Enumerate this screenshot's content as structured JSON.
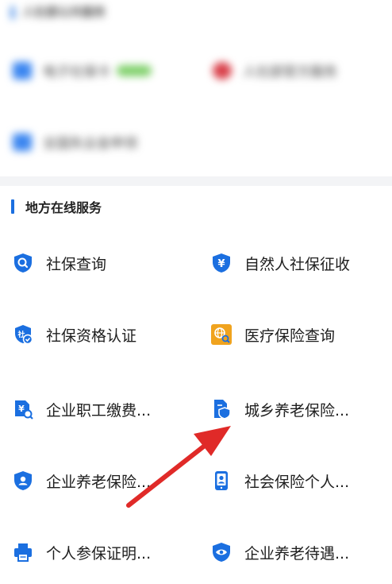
{
  "blurred_section": {
    "title": "人社部公共服务",
    "items": [
      {
        "label": "电子社保卡",
        "icon": "card-icon",
        "badge": ""
      },
      {
        "label": "人社部官方服务",
        "icon": "emblem-icon"
      },
      {
        "label": "全国失业金申领",
        "icon": "document-icon"
      }
    ]
  },
  "local_section": {
    "title": "地方在线服务",
    "items": [
      {
        "label": "社保查询",
        "icon": "shield-search-icon"
      },
      {
        "label": "自然人社保征收",
        "icon": "shield-yen-icon"
      },
      {
        "label": "社保资格认证",
        "icon": "verify-badge-icon"
      },
      {
        "label": "医疗保险查询",
        "icon": "medical-globe-search-icon"
      },
      {
        "label": "企业职工缴费...",
        "icon": "yen-document-search-icon"
      },
      {
        "label": "城乡养老保险...",
        "icon": "document-shield-icon"
      },
      {
        "label": "企业养老保险...",
        "icon": "shield-person-icon"
      },
      {
        "label": "社会保险个人...",
        "icon": "phone-person-icon"
      },
      {
        "label": "个人参保证明...",
        "icon": "printer-icon"
      },
      {
        "label": "企业养老待遇...",
        "icon": "eye-shield-icon"
      }
    ]
  },
  "colors": {
    "accent": "#1b6fe0",
    "arrow": "#e02a28",
    "orange": "#f0a31e"
  }
}
